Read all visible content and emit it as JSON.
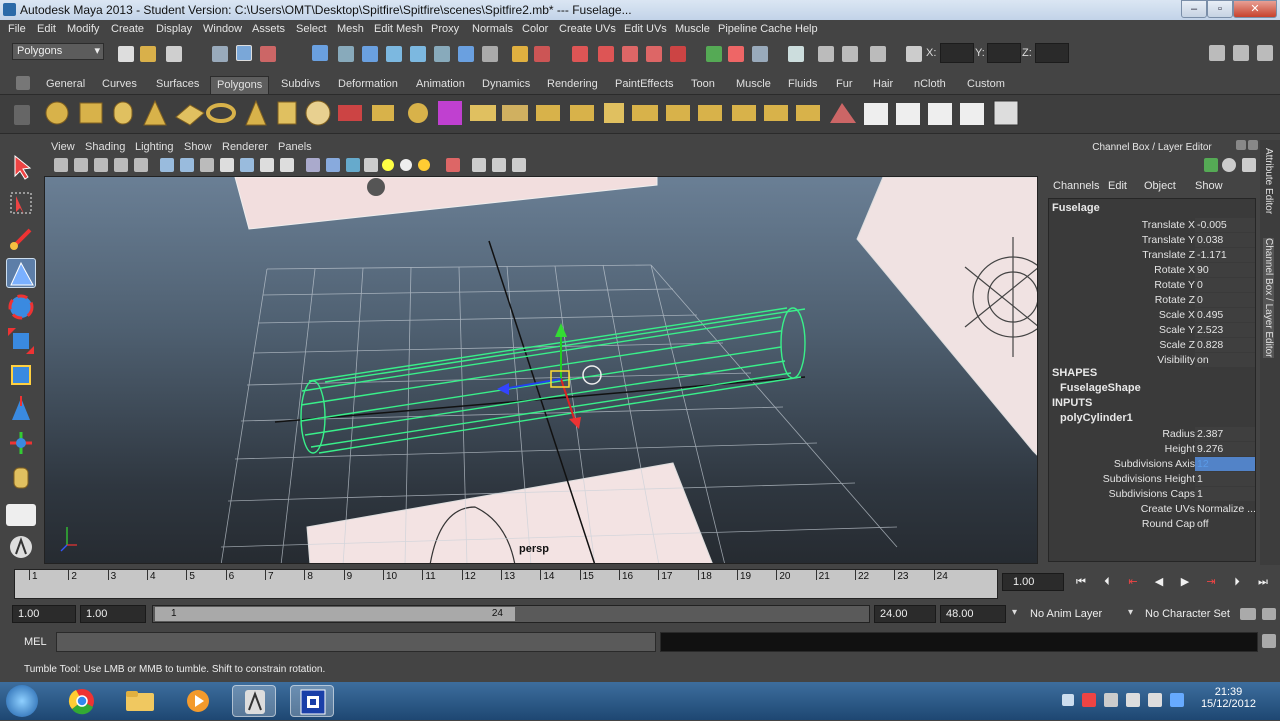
{
  "window": {
    "title": "Autodesk Maya 2013 - Student Version: C:\\Users\\OMT\\Desktop\\Spitfire\\Spitfire\\scenes\\Spitfire2.mb*   ---   Fuselage...",
    "minimize": "–",
    "maximize": "▫",
    "close": "✕"
  },
  "menubar": [
    "File",
    "Edit",
    "Modify",
    "Create",
    "Display",
    "Window",
    "Assets",
    "Select",
    "Mesh",
    "Edit Mesh",
    "Proxy",
    "Normals",
    "Color",
    "Create UVs",
    "Edit UVs",
    "Muscle",
    "Pipeline Cache",
    "Help"
  ],
  "statusline": {
    "mode": "Polygons",
    "x_label": "X:",
    "y_label": "Y:",
    "z_label": "Z:"
  },
  "shelf_tabs": [
    "General",
    "Curves",
    "Surfaces",
    "Polygons",
    "Subdivs",
    "Deformation",
    "Animation",
    "Dynamics",
    "Rendering",
    "PaintEffects",
    "Toon",
    "Muscle",
    "Fluids",
    "Fur",
    "Hair",
    "nCloth",
    "Custom"
  ],
  "shelf_active_tab": "Polygons",
  "viewport": {
    "menu": [
      "View",
      "Shading",
      "Lighting",
      "Show",
      "Renderer",
      "Panels"
    ],
    "camera_label": "persp"
  },
  "channel_box": {
    "title": "Channel Box / Layer Editor",
    "menu": [
      "Channels",
      "Edit",
      "Object",
      "Show"
    ],
    "object_name": "Fuselage",
    "attributes": [
      {
        "name": "Translate X",
        "value": "-0.005"
      },
      {
        "name": "Translate Y",
        "value": "0.038"
      },
      {
        "name": "Translate Z",
        "value": "-1.171"
      },
      {
        "name": "Rotate X",
        "value": "90"
      },
      {
        "name": "Rotate Y",
        "value": "0"
      },
      {
        "name": "Rotate Z",
        "value": "0"
      },
      {
        "name": "Scale X",
        "value": "0.495"
      },
      {
        "name": "Scale Y",
        "value": "2.523"
      },
      {
        "name": "Scale Z",
        "value": "0.828"
      },
      {
        "name": "Visibility",
        "value": "on"
      }
    ],
    "shapes_header": "SHAPES",
    "shape_name": "FuselageShape",
    "inputs_header": "INPUTS",
    "input_name": "polyCylinder1",
    "input_attributes": [
      {
        "name": "Radius",
        "value": "2.387"
      },
      {
        "name": "Height",
        "value": "9.276"
      },
      {
        "name": "Subdivisions Axis",
        "value": "12"
      },
      {
        "name": "Subdivisions Height",
        "value": "1"
      },
      {
        "name": "Subdivisions Caps",
        "value": "1"
      },
      {
        "name": "Create UVs",
        "value": "Normalize ..."
      },
      {
        "name": "Round Cap",
        "value": "off"
      }
    ],
    "side_tabs": [
      "Attribute Editor",
      "Channel Box / Layer Editor"
    ]
  },
  "timeline": {
    "ticks": [
      "1",
      "2",
      "3",
      "4",
      "5",
      "6",
      "7",
      "8",
      "9",
      "10",
      "11",
      "12",
      "13",
      "14",
      "15",
      "16",
      "17",
      "18",
      "19",
      "20",
      "21",
      "22",
      "23",
      "24"
    ],
    "current_frame": "1.00"
  },
  "range": {
    "start": "1.00",
    "playback_start": "1.00",
    "slider_start": "1",
    "slider_end": "24",
    "playback_end": "24.00",
    "end": "48.00",
    "anim_layer": "No Anim Layer",
    "character_set": "No Character Set"
  },
  "command_line": {
    "label": "MEL"
  },
  "help_line": "Tumble Tool: Use LMB or MMB to tumble. Shift to constrain rotation.",
  "taskbar": {
    "time": "21:39",
    "date": "15/12/2012"
  }
}
